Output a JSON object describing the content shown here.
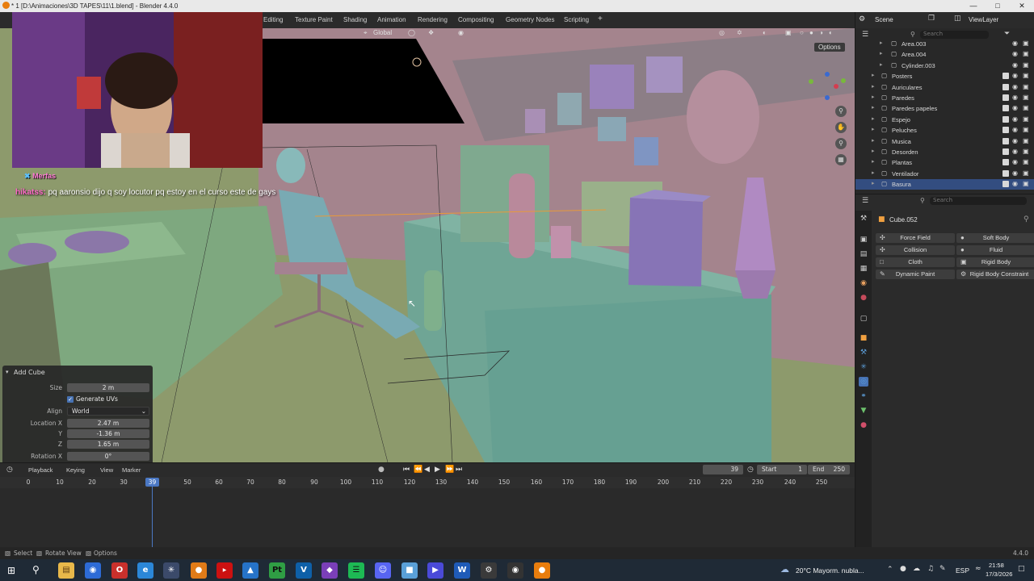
{
  "window": {
    "title": "* 1 [D:\\Animaciones\\3D TAPES\\11\\1.blend] - Blender 4.4.0"
  },
  "workspace_tabs": [
    "Editing",
    "Texture Paint",
    "Shading",
    "Animation",
    "Rendering",
    "Compositing",
    "Geometry Nodes",
    "Scripting",
    "+"
  ],
  "header_right": {
    "scene": "Scene",
    "view_layer": "ViewLayer"
  },
  "viewport": {
    "orientation": "Global",
    "options_label": "Options"
  },
  "overlay_chat": {
    "user_badge": "Merfas",
    "message_user": "hikatss:",
    "message_text": " pq aaronsio dijo q soy locutor pq estoy en el curso este de gays"
  },
  "operator_panel": {
    "title": "Add Cube",
    "size_label": "Size",
    "size_value": "2 m",
    "generate_uvs_label": "Generate UVs",
    "align_label": "Align",
    "align_value": "World",
    "location_x_label": "Location X",
    "location_x": "2.47 m",
    "location_y_label": "Y",
    "location_y": "-1.36 m",
    "location_z_label": "Z",
    "location_z": "1.65 m",
    "rotation_x_label": "Rotation X",
    "rotation_x": "0°",
    "rotation_y_label": "Y",
    "rotation_y": "0°",
    "rotation_z_label": "Z",
    "rotation_z": "0°"
  },
  "timeline": {
    "menus": [
      "Playback",
      "Keying",
      "View",
      "Marker"
    ],
    "current_frame": "39",
    "start_label": "Start",
    "start_value": "1",
    "end_label": "End",
    "end_value": "250",
    "ticks": [
      "0",
      "10",
      "20",
      "30",
      "50",
      "60",
      "70",
      "80",
      "90",
      "100",
      "110",
      "120",
      "130",
      "140",
      "150",
      "160",
      "170",
      "180",
      "190",
      "200",
      "210",
      "220",
      "230",
      "240",
      "250"
    ],
    "playhead": "39"
  },
  "statusbar": {
    "select": "Select",
    "rotate_view": "Rotate View",
    "options": "Options",
    "version": "4.4.0"
  },
  "outliner": {
    "search_placeholder": "Search",
    "rows": [
      {
        "name": "Area.003",
        "indent": 2
      },
      {
        "name": "Area.004",
        "indent": 2
      },
      {
        "name": "Cylinder.003",
        "indent": 2
      },
      {
        "name": "Posters",
        "indent": 1
      },
      {
        "name": "Auriculares",
        "indent": 1
      },
      {
        "name": "Paredes",
        "indent": 1
      },
      {
        "name": "Paredes papeles",
        "indent": 1
      },
      {
        "name": "Espejo",
        "indent": 1
      },
      {
        "name": "Peluches",
        "indent": 1
      },
      {
        "name": "Musica",
        "indent": 1
      },
      {
        "name": "Desorden",
        "indent": 1
      },
      {
        "name": "Plantas",
        "indent": 1
      },
      {
        "name": "Ventilador",
        "indent": 1
      },
      {
        "name": "Basura",
        "indent": 1
      }
    ]
  },
  "properties": {
    "search_placeholder": "Search",
    "object_name": "Cube.052",
    "physics_buttons": [
      "Force Field",
      "Soft Body",
      "Collision",
      "Fluid",
      "Cloth",
      "Rigid Body",
      "Dynamic Paint",
      "Rigid Body Constraint"
    ]
  },
  "taskbar": {
    "weather": "20°C  Mayorm. nubla...",
    "lang": "ESP",
    "time": "21:58",
    "date": "17/3/2026"
  },
  "colors": {
    "accent": "#4772b3",
    "viewport_bg": "#8d9a6c",
    "selected_row": "#334d80"
  }
}
